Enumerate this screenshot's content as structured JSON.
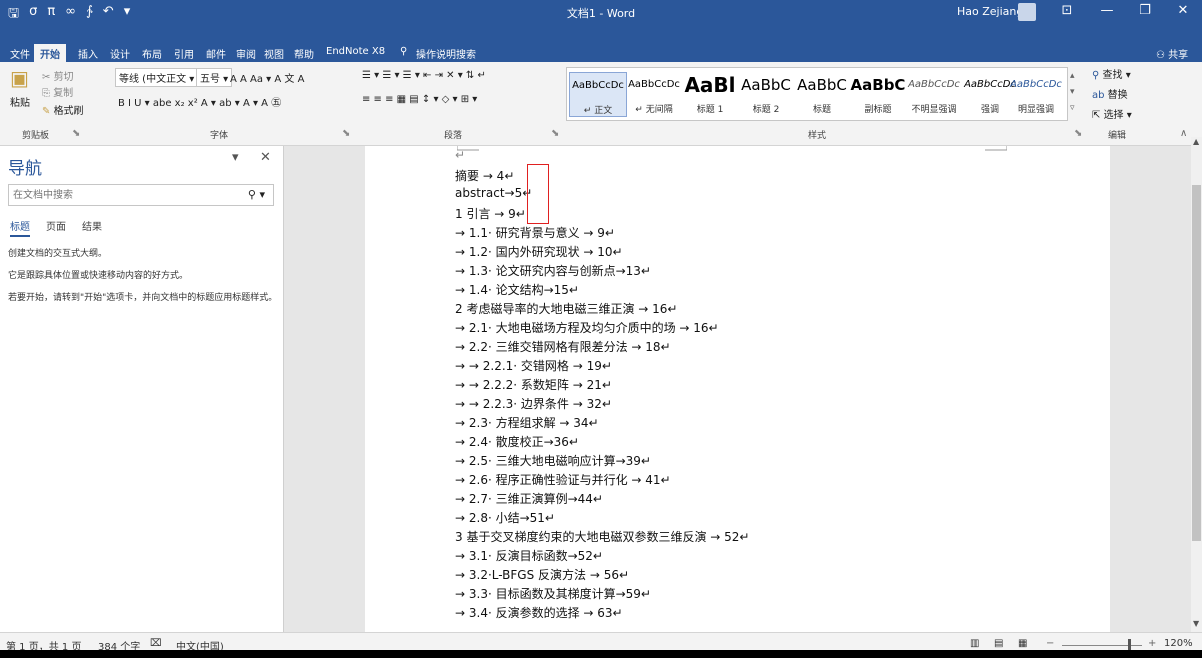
{
  "titlebar": {
    "qat": [
      "🖫",
      "σ",
      "π",
      "∞",
      "∱",
      "↶",
      "▾"
    ],
    "title": "文档1 - Word",
    "user": "Hao Zejiang",
    "buttons": [
      "⊡",
      "—",
      "❐",
      "✕"
    ]
  },
  "tabs": [
    {
      "label": "文件"
    },
    {
      "label": "开始"
    },
    {
      "label": "插入"
    },
    {
      "label": "设计"
    },
    {
      "label": "布局"
    },
    {
      "label": "引用"
    },
    {
      "label": "邮件"
    },
    {
      "label": "审阅"
    },
    {
      "label": "视图"
    },
    {
      "label": "帮助"
    },
    {
      "label": "EndNote X8"
    },
    {
      "label": "操作说明搜索"
    }
  ],
  "share_label": "共享",
  "ribbon": {
    "clipboard": {
      "paste": "粘贴",
      "cut": "剪切",
      "copy": "复制",
      "format_painter": "格式刷",
      "label": "剪贴板"
    },
    "font": {
      "font_name": "等线 (中文正文",
      "font_size": "五号",
      "row1_tail": "A A  Aa ▾  A 文 A",
      "row2": "B  I  U ▾ abe x₂ x²  A ▾  ab ▾  A ▾  A ㊄",
      "label": "字体"
    },
    "paragraph": {
      "row1": "☰ ▾ ☰ ▾ ☰ ▾  ⇤ ⇥  ✕ ▾  ⇅  ↵",
      "row2": "≡  ≡  ≡  ▦  ▤  ↕ ▾  ◇ ▾  ⊞ ▾",
      "label": "段落"
    },
    "styles": {
      "items": [
        {
          "sample": "AaBbCcDc",
          "name": "↵ 正文"
        },
        {
          "sample": "AaBbCcDc",
          "name": "↵ 无间隔"
        },
        {
          "sample": "AaBl",
          "name": "标题 1"
        },
        {
          "sample": "AaBbC",
          "name": "标题 2"
        },
        {
          "sample": "AaBbC",
          "name": "标题"
        },
        {
          "sample": "AaBbC",
          "name": "副标题"
        },
        {
          "sample": "AaBbCcDc",
          "name": "不明显强调"
        },
        {
          "sample": "AaBbCcDc",
          "name": "强调"
        },
        {
          "sample": "AaBbCcDc",
          "name": "明显强调"
        }
      ],
      "label": "样式"
    },
    "editing": {
      "find": "查找",
      "replace": "替换",
      "select": "选择",
      "label": "编辑"
    }
  },
  "nav": {
    "title": "导航",
    "search_placeholder": "在文档中搜索",
    "tabs": [
      "标题",
      "页面",
      "结果"
    ],
    "messages": [
      "创建文档的交互式大纲。",
      "它是跟踪具体位置或快速移动内容的好方式。",
      "若要开始，请转到\"开始\"选项卡，并向文档中的标题应用标题样式。"
    ]
  },
  "document": {
    "lines": [
      "↵",
      "摘要 → 4↵",
      "abstract→5↵",
      "1 引言 → 9↵",
      "  → 1.1· 研究背景与意义 → 9↵",
      "  → 1.2· 国内外研究现状 → 10↵",
      "  → 1.3· 论文研究内容与创新点→13↵",
      "  → 1.4· 论文结构→15↵",
      "2 考虑磁导率的大地电磁三维正演 → 16↵",
      "  → 2.1· 大地电磁场方程及均匀介质中的场 → 16↵",
      "  → 2.2· 三维交错网格有限差分法 → 18↵",
      "  →   → 2.2.1· 交错网格 → 19↵",
      "  →   → 2.2.2· 系数矩阵 → 21↵",
      "  →   → 2.2.3· 边界条件 → 32↵",
      "  → 2.3· 方程组求解 → 34↵",
      "  → 2.4· 散度校正→36↵",
      "  → 2.5· 三维大地电磁响应计算→39↵",
      "  → 2.6· 程序正确性验证与并行化 → 41↵",
      "  → 2.7· 三维正演算例→44↵",
      "  → 2.8· 小结→51↵",
      "3 基于交叉梯度约束的大地电磁双参数三维反演 → 52↵",
      "  → 3.1· 反演目标函数→52↵",
      "  → 3.2·L-BFGS 反演方法 → 56↵",
      "  → 3.3· 目标函数及其梯度计算→59↵",
      "  → 3.4· 反演参数的选择 → 63↵"
    ]
  },
  "status": {
    "page": "第 1 页，共 1 页",
    "words": "384 个字",
    "lang": "中文(中国)",
    "zoom": "120%"
  }
}
